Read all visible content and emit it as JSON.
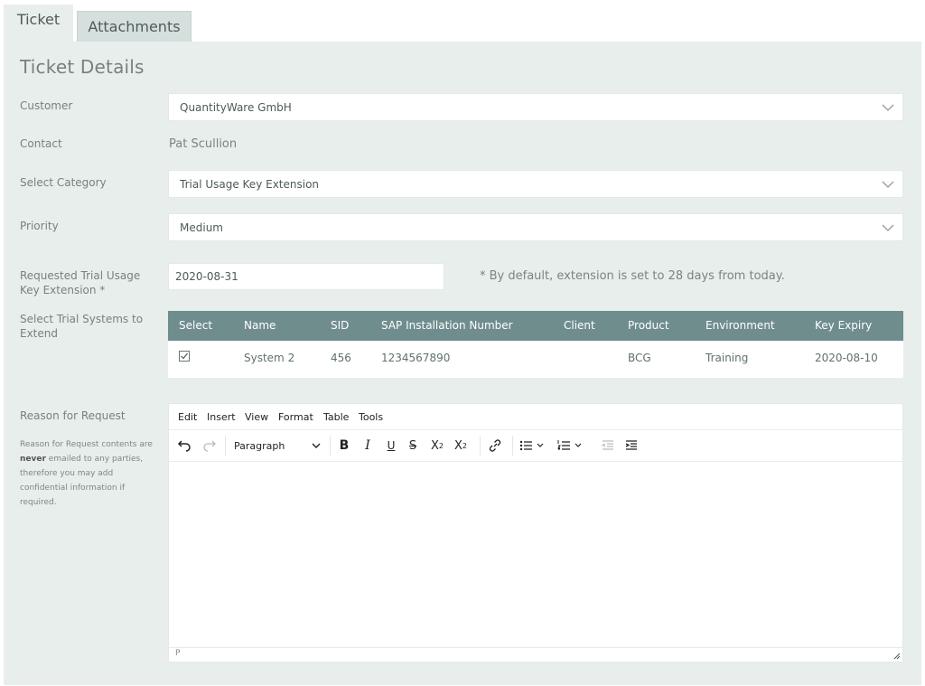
{
  "tabs": [
    {
      "label": "Ticket",
      "active": true
    },
    {
      "label": "Attachments",
      "active": false
    }
  ],
  "section_title": "Ticket Details",
  "fields": {
    "customer": {
      "label": "Customer",
      "value": "QuantityWare GmbH"
    },
    "contact": {
      "label": "Contact",
      "value": "Pat Scullion"
    },
    "category": {
      "label": "Select Category",
      "value": "Trial Usage Key Extension"
    },
    "priority": {
      "label": "Priority",
      "value": "Medium"
    },
    "requested": {
      "label": "Requested Trial Usage Key Extension *",
      "value": "2020-08-31",
      "hint": "* By default, extension is set to 28 days from today."
    },
    "systems": {
      "label": "Select Trial Systems to Extend"
    },
    "reason": {
      "label": "Reason for Request",
      "note_prefix": "Reason for Request contents are",
      "note_bold": "never",
      "note_suffix": "emailed to any parties, therefore you may add confidential information if required."
    }
  },
  "table": {
    "headers": [
      "Select",
      "Name",
      "SID",
      "SAP Installation Number",
      "Client",
      "Product",
      "Environment",
      "Key Expiry"
    ],
    "rows": [
      {
        "select": true,
        "name": "System 2",
        "sid": "456",
        "sap": "1234567890",
        "client": "",
        "product": "BCG",
        "environment": "Training",
        "expiry": "2020-08-10"
      }
    ]
  },
  "editor": {
    "menus": [
      "Edit",
      "Insert",
      "View",
      "Format",
      "Table",
      "Tools"
    ],
    "block_format": "Paragraph",
    "status_path": "P",
    "toolbar_icons": [
      "undo-icon",
      "redo-icon",
      "bold-icon",
      "italic-icon",
      "underline-icon",
      "strikethrough-icon",
      "superscript-icon",
      "subscript-icon",
      "link-icon",
      "bullet-list-icon",
      "numbered-list-icon",
      "outdent-icon",
      "indent-icon"
    ]
  },
  "colors": {
    "panel_bg": "#e8eeec",
    "table_header_bg": "#708d8d",
    "tab_inactive_bg": "#d5dfdd"
  }
}
